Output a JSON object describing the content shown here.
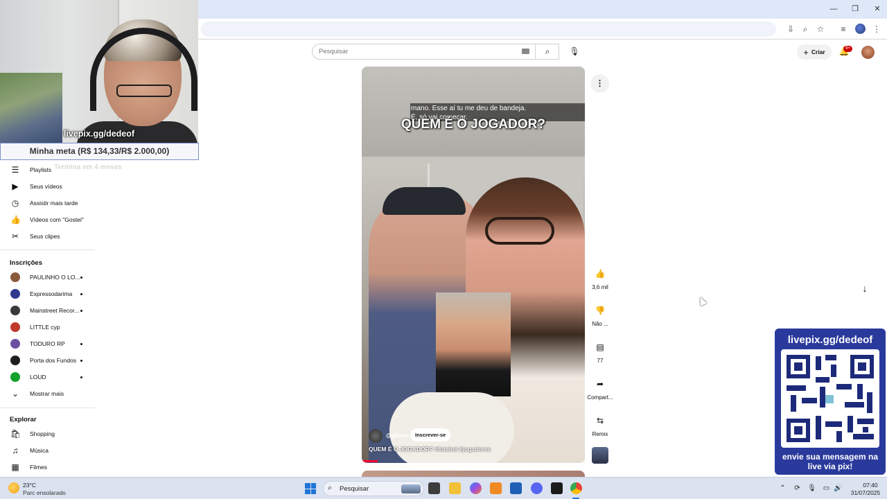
{
  "window": {
    "minimize": "—",
    "maximize": "❐",
    "close": "✕"
  },
  "webcam": {
    "tag": "livepix.gg/dedeof",
    "goal": "Minha meta (R$ 134,33/R$ 2.000,00)",
    "goal_sub": "Termina em 4 meses"
  },
  "sidebar": {
    "items": [
      {
        "label": "Playlists",
        "icon": "playlist-icon"
      },
      {
        "label": "Seus vídeos",
        "icon": "video-icon"
      },
      {
        "label": "Assistir mais tarde",
        "icon": "clock-icon"
      },
      {
        "label": "Vídeos com \"Gostei\"",
        "icon": "thumb-up-icon"
      },
      {
        "label": "Seus clipes",
        "icon": "scissors-icon"
      }
    ],
    "subs_heading": "Inscrições",
    "subscriptions": [
      {
        "name": "PAULINHO O LO...",
        "color": "#8a5a3c",
        "dot": true
      },
      {
        "name": "Expressodarima",
        "color": "#2f3a8f",
        "dot": true
      },
      {
        "name": "Mainstreet Recor...",
        "color": "#3a3a3a",
        "dot": true
      },
      {
        "name": "LITTLE cyp",
        "color": "#c0392b",
        "dot": false
      },
      {
        "name": "TODURO RP",
        "color": "#6b4fa3",
        "dot": true
      },
      {
        "name": "Porta dos Fundos",
        "color": "#1e1e1e",
        "dot": true
      },
      {
        "name": "LOUD",
        "color": "#12a12a",
        "dot": true
      }
    ],
    "show_more": "Mostrar mais",
    "explore_heading": "Explorar",
    "explore": [
      {
        "label": "Shopping",
        "icon": "shopping-bag-icon"
      },
      {
        "label": "Música",
        "icon": "music-icon"
      },
      {
        "label": "Filmes",
        "icon": "film-icon"
      }
    ]
  },
  "header": {
    "search_placeholder": "Pesquisar",
    "create_label": "Criar",
    "notif_badge": "9+"
  },
  "video": {
    "caption_line1": "mano. Esse aí tu me deu de bandeja.",
    "caption_line2": "É, só vai começar.",
    "overlay_title": "QUEM É O JOGADOR?",
    "channel": "@gflxss",
    "subscribe": "Inscrever-se",
    "description": "QUEM É O JOGADOR? #futebol #jogadores",
    "progress": 0.07
  },
  "actions": {
    "like_count": "3,6 mil",
    "dislike_label": "Não ...",
    "comment_count": "77",
    "share_label": "Compart...",
    "remix_label": "Remix"
  },
  "qr_overlay": {
    "url": "livepix.gg/dedeof",
    "message": "envie sua mensagem na live via pix!"
  },
  "taskbar": {
    "temp": "23°C",
    "weather": "Parc ensolarado",
    "search_label": "Pesquisar",
    "time": "07:40",
    "date": "31/07/2025"
  }
}
